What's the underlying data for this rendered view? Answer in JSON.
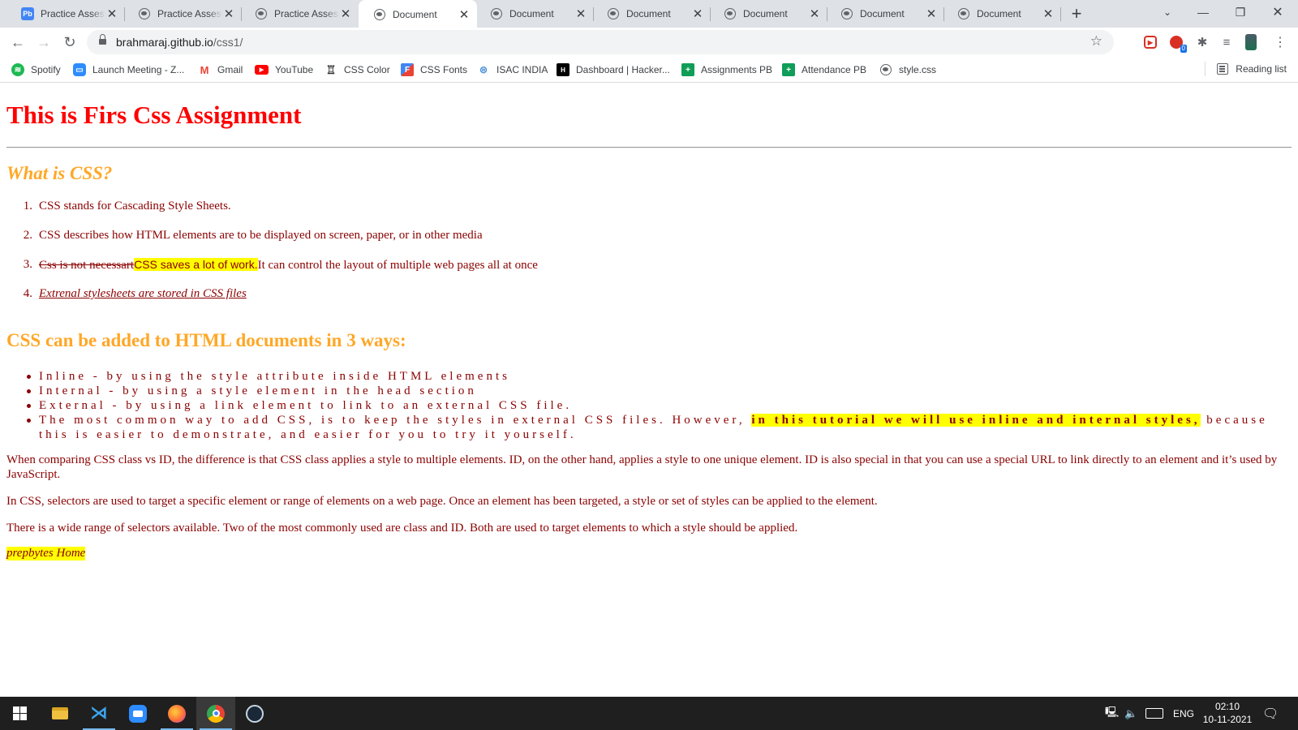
{
  "tabs": [
    {
      "title": "Practice Assessment",
      "icon": "pb"
    },
    {
      "title": "Practice Assessment",
      "icon": "globe"
    },
    {
      "title": "Practice Assessment",
      "icon": "globe"
    },
    {
      "title": "Document",
      "icon": "globe"
    },
    {
      "title": "Document",
      "icon": "globe"
    },
    {
      "title": "Document",
      "icon": "globe"
    },
    {
      "title": "Document",
      "icon": "globe"
    },
    {
      "title": "Document",
      "icon": "globe"
    },
    {
      "title": "Document",
      "icon": "globe"
    }
  ],
  "address": {
    "host": "brahmaraj.github.io",
    "path": "/css1/"
  },
  "extensions": {
    "badge_count": "0"
  },
  "bookmarks": [
    {
      "label": "Spotify",
      "icon": "spotify-icon",
      "color": "#1db954"
    },
    {
      "label": "Launch Meeting - Z...",
      "icon": "zoom-icon",
      "color": "#2d8cff"
    },
    {
      "label": "Gmail",
      "icon": "gmail-icon",
      "color": "#ea4335"
    },
    {
      "label": "YouTube",
      "icon": "youtube-icon",
      "color": "#ff0000"
    },
    {
      "label": "CSS Color",
      "icon": "css-color-icon",
      "color": "#333333"
    },
    {
      "label": "CSS Fonts",
      "icon": "css-fonts-icon",
      "color": "#4285f4"
    },
    {
      "label": "ISAC INDIA",
      "icon": "isac-icon",
      "color": "#4a90d9"
    },
    {
      "label": "Dashboard | Hacker...",
      "icon": "hackerrank-icon",
      "color": "#000000"
    },
    {
      "label": "Assignments PB",
      "icon": "sheets-icon",
      "color": "#0f9d58"
    },
    {
      "label": "Attendance PB",
      "icon": "sheets-icon",
      "color": "#0f9d58"
    },
    {
      "label": "style.css",
      "icon": "globe-icon",
      "color": "#5f6368"
    }
  ],
  "reading_list": "Reading list",
  "page": {
    "heading": "This is Firs Css Assignment",
    "subheading1": "What is CSS?",
    "ordered": {
      "item1": "CSS stands for Cascading Style Sheets.",
      "item2": "CSS describes how HTML elements are to be displayed on screen, paper, or in other media",
      "item3_strike": "Css is not necessart",
      "item3_highlight": "CSS saves a lot of work.",
      "item3_rest": "It can control the layout of multiple web pages all at once",
      "item4": "Extrenal stylesheets are stored in CSS files"
    },
    "subheading2": "CSS can be added to HTML documents in 3 ways:",
    "bullets": {
      "item1": "Inline - by using the style attribute inside HTML elements",
      "item2": "Internal - by using a style element in the head section",
      "item3": "External - by using a link element to link to an external CSS file.",
      "item4_start": "The most common way to add CSS, is to keep the styles in external CSS files. However, ",
      "item4_highlight": "in this tutorial we will use inline and internal styles,",
      "item4_end": " because this is easier to demonstrate, and easier for you to try it yourself."
    },
    "para1": "When comparing CSS class vs ID, the difference is that CSS class applies a style to multiple elements. ID, on the other hand, applies a style to one unique element. ID is also special in that you can use a special URL to link directly to an element and it’s used by JavaScript.",
    "para2": "In CSS, selectors are used to target a specific element or range of elements on a web page. Once an element has been targeted, a style or set of styles can be applied to the element.",
    "para3": "There is a wide range of selectors available. Two of the most commonly used are class and ID. Both are used to target elements to which a style should be applied.",
    "home_link": "prepbytes Home"
  },
  "colors": {
    "heading": "#ff0000",
    "subheading": "#ffa726",
    "body_text": "#8b0000",
    "highlight": "#ffff00"
  },
  "taskbar": {
    "language": "ENG",
    "time": "02:10",
    "date": "10-11-2021"
  }
}
